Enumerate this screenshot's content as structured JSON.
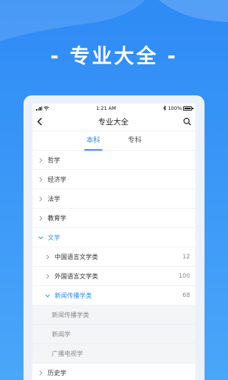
{
  "headline": "- 专业大全 -",
  "colors": {
    "accent": "#2c8cf3",
    "background": "#3a97f7"
  },
  "status_bar": {
    "time": "1:21 AM",
    "battery": "100%"
  },
  "nav": {
    "title": "专业大全",
    "back_icon": "chevron-left-icon",
    "search_icon": "search-icon"
  },
  "tabs": [
    {
      "label": "本科",
      "active": true
    },
    {
      "label": "专科",
      "active": false
    }
  ],
  "categories": [
    {
      "label": "哲学",
      "expanded": false
    },
    {
      "label": "经济学",
      "expanded": false
    },
    {
      "label": "法学",
      "expanded": false
    },
    {
      "label": "教育学",
      "expanded": false
    },
    {
      "label": "文学",
      "expanded": true
    }
  ],
  "subcategories": [
    {
      "label": "中国语言文学类",
      "count": "12",
      "expanded": false
    },
    {
      "label": "外国语言文学类",
      "count": "100",
      "expanded": false
    },
    {
      "label": "新闻传播学类",
      "count": "68",
      "expanded": true
    }
  ],
  "majors": [
    "新闻传播学类",
    "新闻学",
    "广播电视学"
  ],
  "next_category": {
    "label": "历史学"
  }
}
